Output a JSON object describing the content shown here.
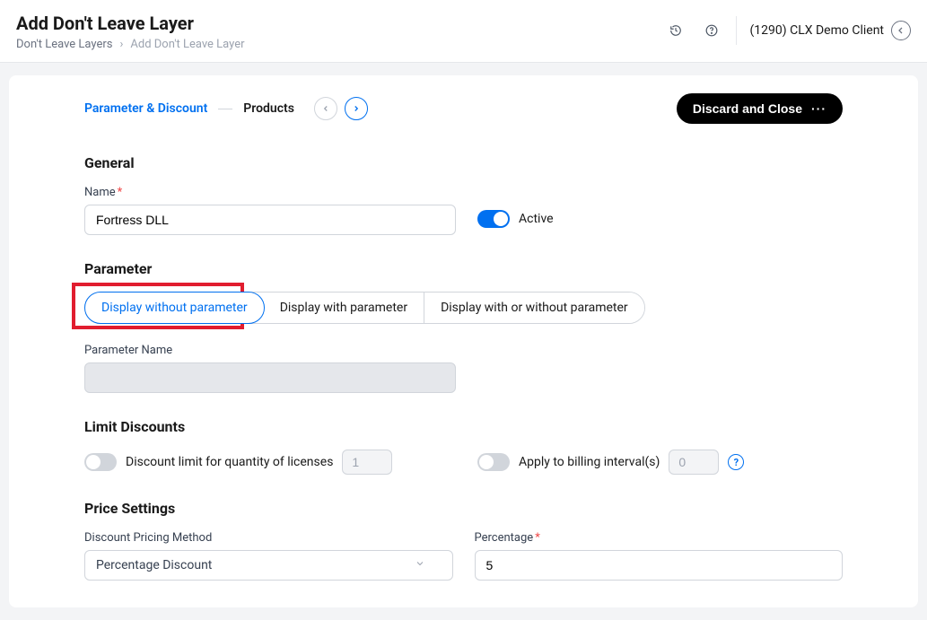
{
  "header": {
    "title": "Add Don't Leave Layer",
    "breadcrumb_root": "Don't Leave Layers",
    "breadcrumb_current": "Add Don't Leave Layer",
    "client_label": "(1290) CLX Demo Client"
  },
  "topbar": {
    "step1": "Parameter & Discount",
    "step2": "Products",
    "discard_label": "Discard and Close"
  },
  "general": {
    "heading": "General",
    "name_label": "Name",
    "name_value": "Fortress DLL",
    "active_label": "Active",
    "active_on": true
  },
  "parameter": {
    "heading": "Parameter",
    "opt1": "Display without parameter",
    "opt2": "Display with parameter",
    "opt3": "Display with or without parameter",
    "param_name_label": "Parameter Name",
    "param_name_value": ""
  },
  "limits": {
    "heading": "Limit Discounts",
    "license_label": "Discount limit for quantity of licenses",
    "license_value": "1",
    "interval_label": "Apply to billing interval(s)",
    "interval_value": "0"
  },
  "price": {
    "heading": "Price Settings",
    "method_label": "Discount Pricing Method",
    "method_value": "Percentage Discount",
    "pct_label": "Percentage",
    "pct_value": "5"
  }
}
